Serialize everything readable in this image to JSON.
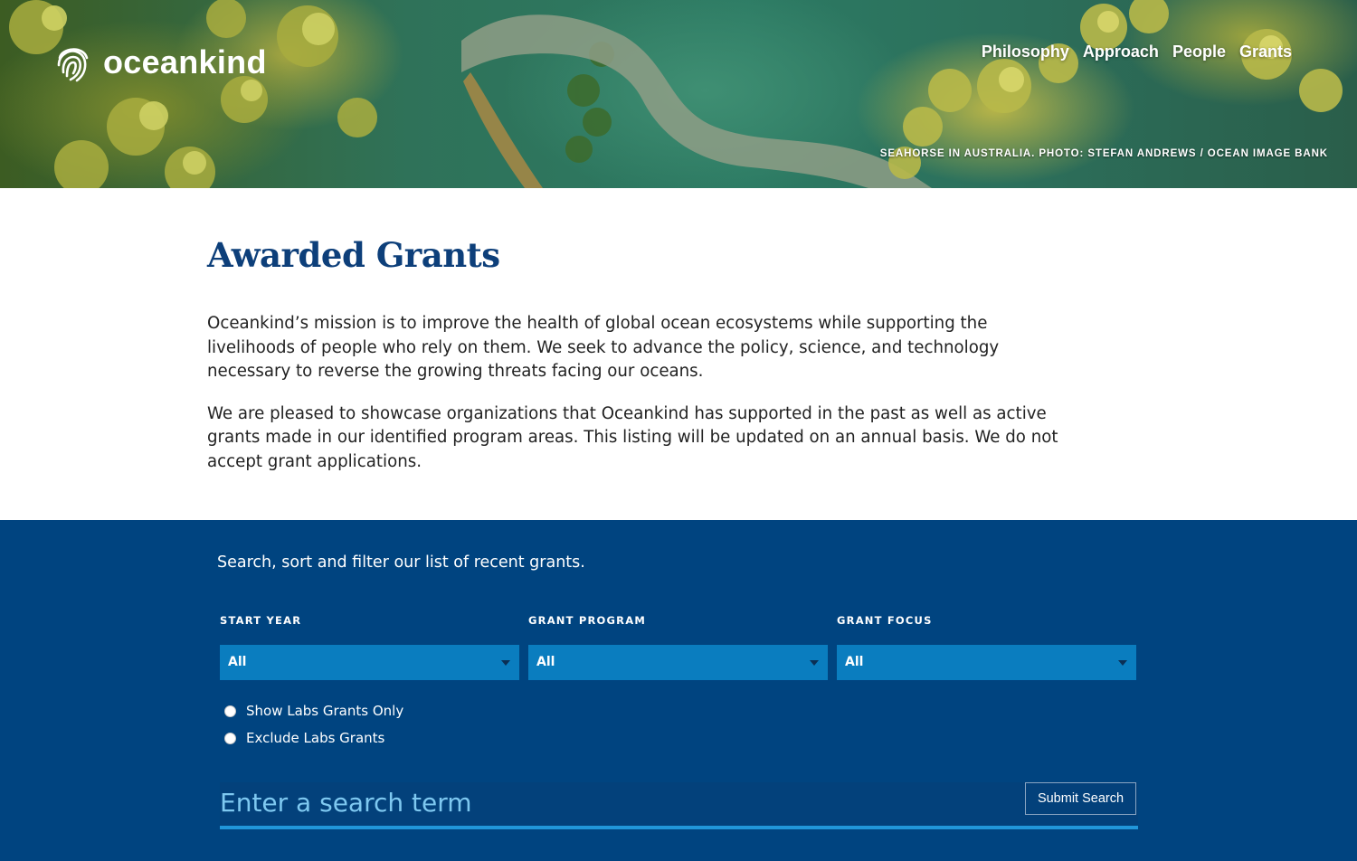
{
  "brand": {
    "name": "oceankind"
  },
  "nav": {
    "items": [
      {
        "label": "Philosophy"
      },
      {
        "label": "Approach"
      },
      {
        "label": "People"
      },
      {
        "label": "Grants"
      }
    ]
  },
  "hero": {
    "credit": "SEAHORSE IN AUSTRALIA. PHOTO: STEFAN ANDREWS / OCEAN IMAGE BANK"
  },
  "intro": {
    "title": "Awarded Grants",
    "paragraphs": [
      "Oceankind’s mission is to improve the health of global ocean ecosystems while supporting the livelihoods of people who rely on them. We seek to advance the policy, science, and technology necessary to reverse the growing threats facing our oceans.",
      "We are pleased to showcase organizations that Oceankind has supported in the past as well as active grants made in our identified program areas. This listing will be updated on an annual basis. We do not accept grant applications."
    ]
  },
  "filter": {
    "title": "Search, sort and filter our list of recent grants.",
    "fields": [
      {
        "label": "START YEAR",
        "value": "All"
      },
      {
        "label": "GRANT PROGRAM",
        "value": "All"
      },
      {
        "label": "GRANT FOCUS",
        "value": "All"
      }
    ],
    "radios": [
      {
        "label": "Show Labs Grants Only"
      },
      {
        "label": "Exclude Labs Grants"
      }
    ],
    "search": {
      "placeholder": "Enter a search term",
      "submit_label": "Submit Search"
    }
  },
  "colors": {
    "brand_navy": "#004480",
    "select_blue": "#0a7dbf",
    "title_blue": "#0d3f7a",
    "placeholder": "#7ec8f0"
  }
}
